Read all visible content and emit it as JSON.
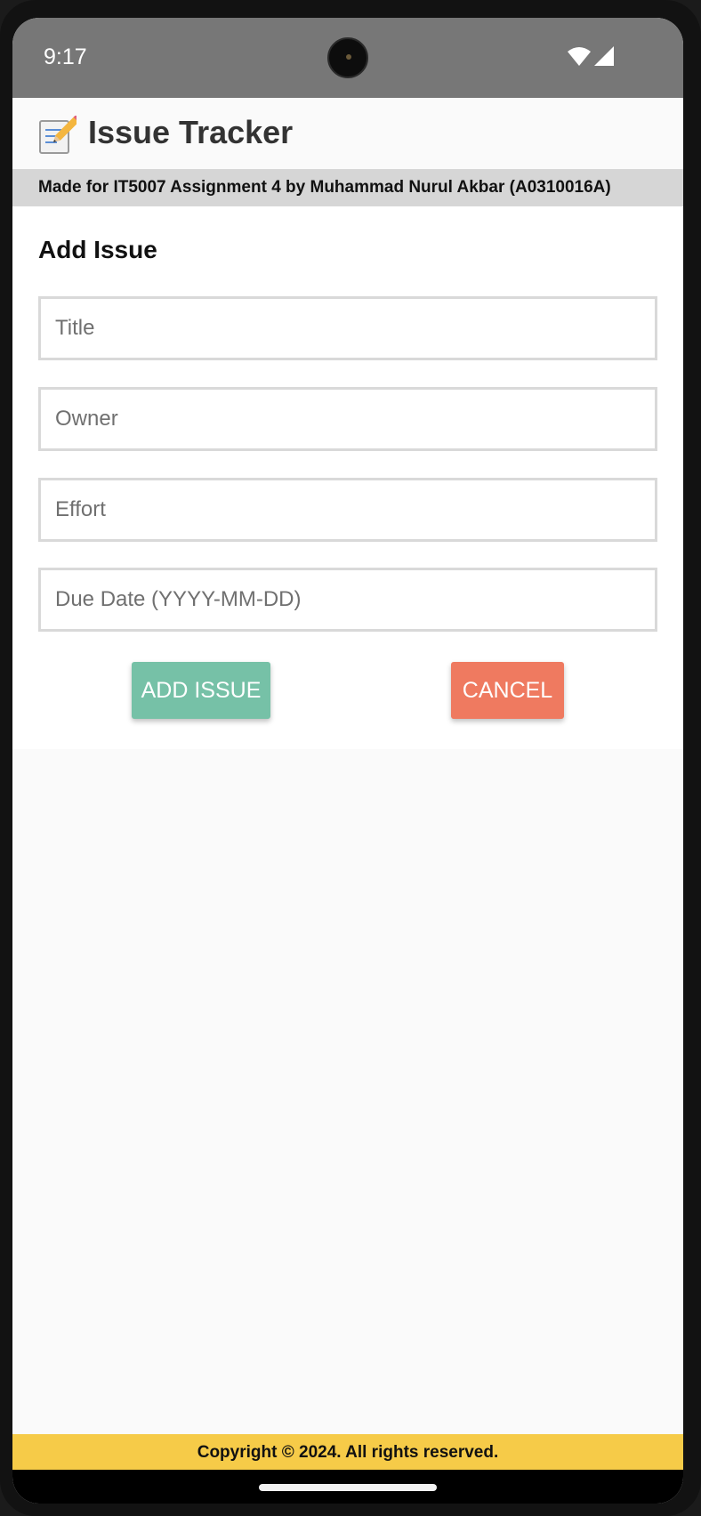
{
  "status_bar": {
    "time": "9:17",
    "icons": [
      "wifi-icon",
      "cellular-signal-icon"
    ]
  },
  "app": {
    "logo_icon": "memo-pencil-icon",
    "title": "Issue Tracker",
    "credits": "Made for IT5007 Assignment 4 by Muhammad Nurul Akbar (A0310016A)"
  },
  "form": {
    "heading": "Add Issue",
    "fields": {
      "title": {
        "placeholder": "Title",
        "value": ""
      },
      "owner": {
        "placeholder": "Owner",
        "value": ""
      },
      "effort": {
        "placeholder": "Effort",
        "value": ""
      },
      "due_date": {
        "placeholder": "Due Date (YYYY-MM-DD)",
        "value": ""
      }
    },
    "add_label": "ADD ISSUE",
    "cancel_label": "CANCEL"
  },
  "footer": {
    "text": "Copyright © 2024. All rights reserved."
  },
  "colors": {
    "status_bar": "#777777",
    "add_button": "#76c1a7",
    "cancel_button": "#ef7a60",
    "footer": "#f6cb48",
    "credits_bar": "#d6d6d6"
  }
}
